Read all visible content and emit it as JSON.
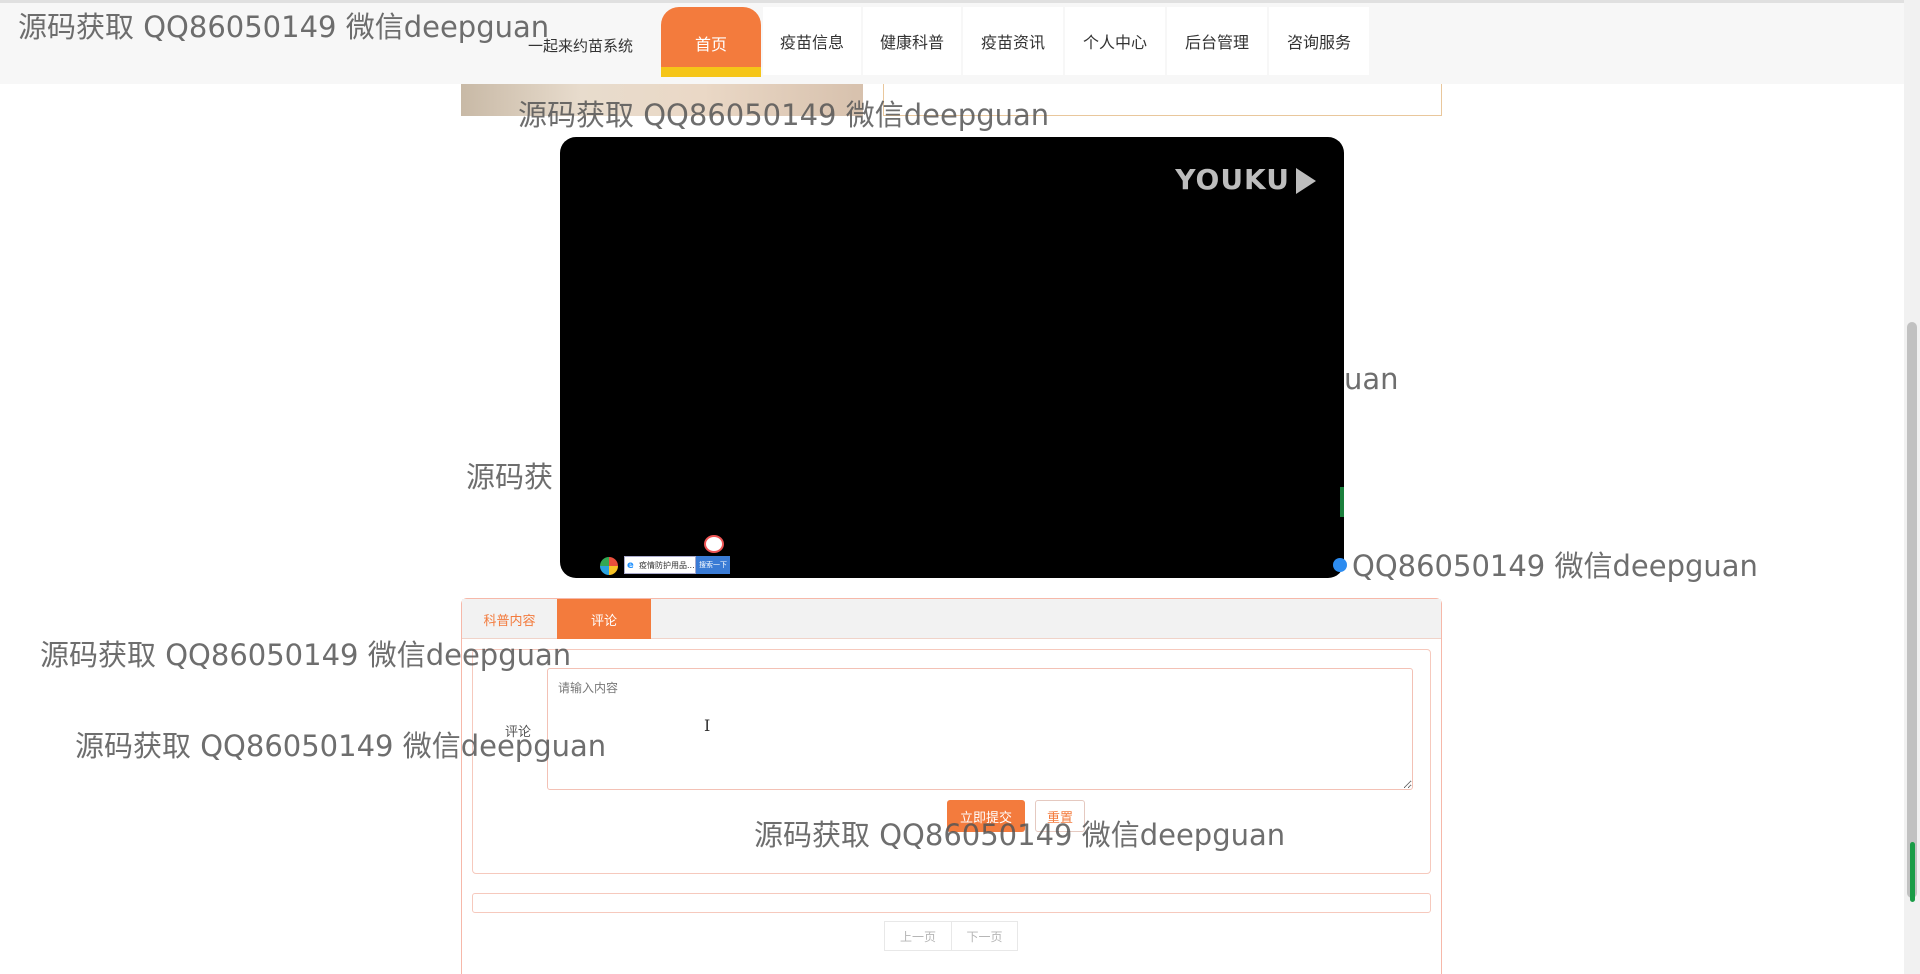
{
  "header": {
    "brand": "一起来约苗系统",
    "nav": [
      {
        "label": "首页",
        "active": true
      },
      {
        "label": "疫苗信息",
        "active": false
      },
      {
        "label": "健康科普",
        "active": false
      },
      {
        "label": "疫苗资讯",
        "active": false
      },
      {
        "label": "个人中心",
        "active": false
      },
      {
        "label": "后台管理",
        "active": false
      },
      {
        "label": "咨询服务",
        "active": false
      }
    ]
  },
  "video": {
    "logo_text": "YOUKU",
    "taskbar_search_text": "疫情防护用品...",
    "taskbar_button_text": "搜索一下"
  },
  "tabs": [
    {
      "label": "科普内容",
      "active": false
    },
    {
      "label": "评论",
      "active": true
    }
  ],
  "comment": {
    "label": "评论",
    "placeholder": "请输入内容",
    "submit_label": "立即提交",
    "reset_label": "重置"
  },
  "pager": {
    "prev_label": "上一页",
    "next_label": "下一页"
  },
  "watermark": {
    "full": "源码获取 QQ86050149 微信deepguan",
    "partial_left": "源码获",
    "partial_right_1": "uan",
    "partial_right_2": "QQ86050149 微信deepguan"
  },
  "colors": {
    "accent": "#f37b3d",
    "nav_underline": "#f5c518",
    "panel_border": "#f6b8a9"
  }
}
